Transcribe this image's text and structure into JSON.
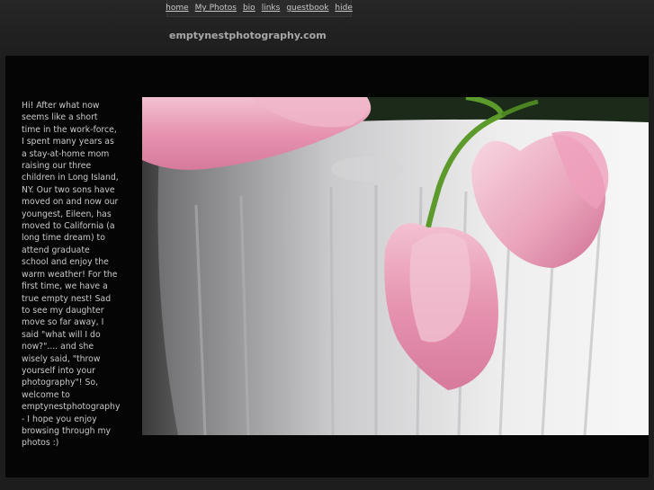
{
  "nav": {
    "links": [
      {
        "label": "home"
      },
      {
        "label": "My Photos"
      },
      {
        "label": "bio"
      },
      {
        "label": "links"
      },
      {
        "label": "guestbook"
      },
      {
        "label": "hide"
      }
    ]
  },
  "site": {
    "title": "emptynestphotography.com"
  },
  "bio": {
    "text": "Hi! After what now seems like a short time in the work-force, I spent many years as a stay-at-home mom raising our three children in Long Island, NY. Our two sons have moved on and now our youngest, Eileen, has moved to California (a long time dream) to attend graduate school and enjoy the warm weather! For the first time, we have a true empty nest! Sad to see my daughter move so far away, I said \"what will I do now?\".... and she wisely said, \"throw yourself into your photography\"! So, welcome to emptynestphotography - I hope you enjoy browsing through my photos :)"
  },
  "photo": {
    "subject": "pink tulips in white vase",
    "colors": {
      "petal": "#e89bb5",
      "petal_light": "#f6d3de",
      "stem": "#5c9a2c",
      "vase": "#e9e9ea"
    }
  }
}
